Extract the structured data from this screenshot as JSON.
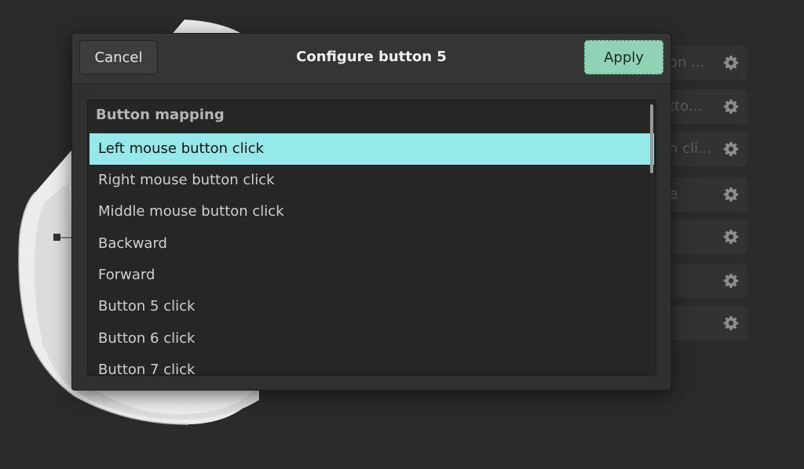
{
  "dialog": {
    "title": "Configure button 5",
    "cancel_label": "Cancel",
    "apply_label": "Apply"
  },
  "list": {
    "header": "Button mapping",
    "items": [
      "Left mouse button click",
      "Right mouse button click",
      "Middle mouse button click",
      "Backward",
      "Forward",
      "Button 5 click",
      "Button 6 click",
      "Button 7 click"
    ],
    "selected_index": 0
  },
  "background_rows": [
    {
      "text": "on ...",
      "icon": "gear-icon"
    },
    {
      "text": "tto...",
      "icon": "gear-icon"
    },
    {
      "text": "n cli...",
      "icon": "gear-icon"
    },
    {
      "text": "e",
      "icon": "gear-icon"
    },
    {
      "text": "",
      "icon": "gear-icon"
    },
    {
      "text": "",
      "icon": "gear-icon"
    },
    {
      "text": "",
      "icon": "gear-icon"
    }
  ],
  "colors": {
    "background": "#2b2b2b",
    "dialog": "#303030",
    "selection": "#96e9ea",
    "apply_button": "#8fd3b4"
  }
}
